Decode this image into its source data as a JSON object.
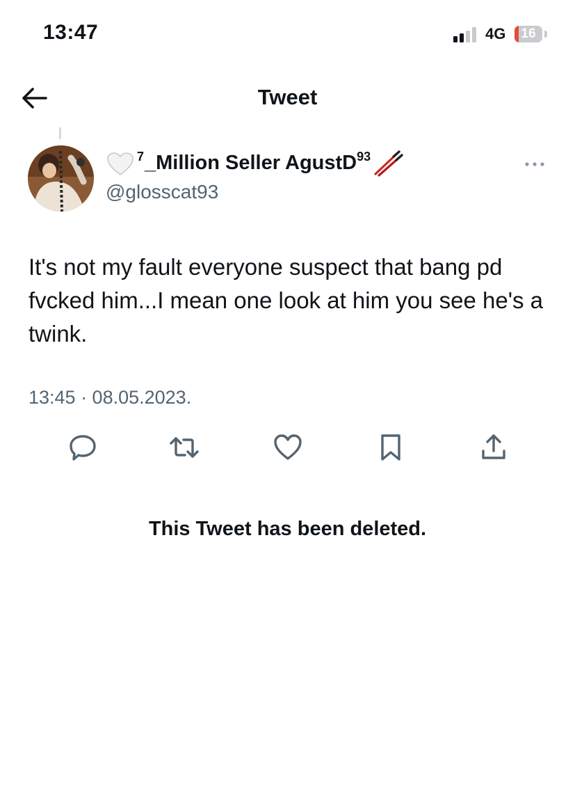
{
  "status_bar": {
    "time": "13:47",
    "network": "4G",
    "battery": "16",
    "battery_level_percent": 16,
    "signal_bars_active": 2,
    "signal_bars_total": 4
  },
  "header": {
    "title": "Tweet",
    "back_icon": "arrow-left-icon"
  },
  "tweet": {
    "author": {
      "display_name_prefix": "7",
      "display_name_main": "_Million Seller AgustD",
      "display_name_suffix": "93",
      "handle": "@glosscat93",
      "leading_emoji": "white-heart-icon",
      "trailing_emoji": "chopsticks-icon"
    },
    "text": "It's not my fault everyone suspect that bang pd fvcked him...I mean one look at him you see he's a twink.",
    "timestamp": "13:45 · 08.05.2023.",
    "actions": [
      "reply-icon",
      "retweet-icon",
      "like-icon",
      "bookmark-icon",
      "share-icon"
    ],
    "more_icon": "more-options-icon"
  },
  "deleted_notice": "This Tweet has been deleted.",
  "colors": {
    "primary_text": "#0f1419",
    "secondary_text": "#536471",
    "icon_gray": "#536471",
    "battery_low": "#e24c3e"
  }
}
